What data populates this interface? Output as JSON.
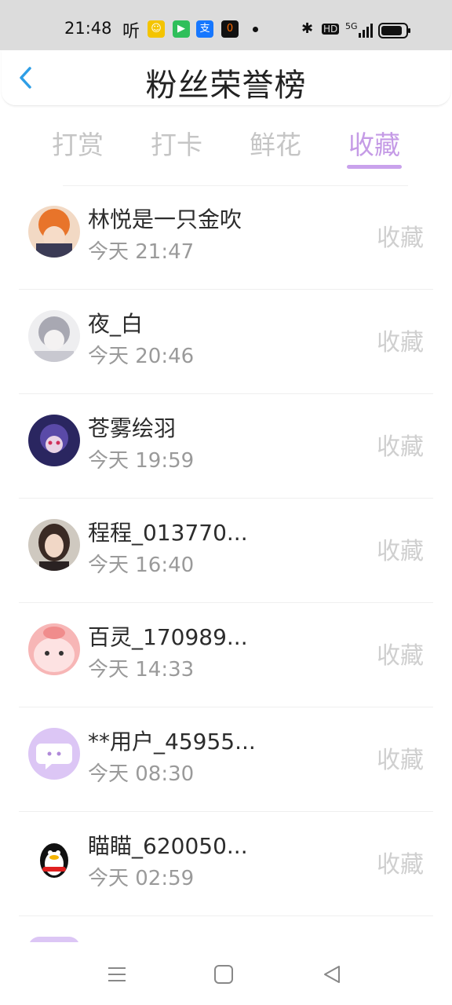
{
  "status_bar": {
    "time": "21:48",
    "app_text": "听",
    "network": "5G",
    "hd": "HD",
    "icons": [
      "bluetooth-icon",
      "signal-icon",
      "battery-icon"
    ]
  },
  "header": {
    "title": "粉丝荣誉榜",
    "back_icon": "chevron-left-icon"
  },
  "tabs": [
    {
      "label": "打赏"
    },
    {
      "label": "打卡"
    },
    {
      "label": "鲜花"
    },
    {
      "label": "收藏"
    }
  ],
  "active_tab": "收藏",
  "colors": {
    "accent": "#c59be6",
    "back": "#2e9ee6",
    "muted": "#cfcfcf"
  },
  "fans": [
    {
      "name": "林悦是一只金吹",
      "time": "今天 21:47",
      "action": "收藏"
    },
    {
      "name": "夜_白",
      "time": "今天 20:46",
      "action": "收藏"
    },
    {
      "name": "苍雾绘羽",
      "time": "今天 19:59",
      "action": "收藏"
    },
    {
      "name": "程程_013770...",
      "time": "今天 16:40",
      "action": "收藏"
    },
    {
      "name": "百灵_170989...",
      "time": "今天 14:33",
      "action": "收藏"
    },
    {
      "name": "**用户_45955...",
      "time": "今天 08:30",
      "action": "收藏"
    },
    {
      "name": "瞄瞄_620050...",
      "time": "今天 02:59",
      "action": "收藏"
    }
  ],
  "nav": [
    "menu-icon",
    "home-square-icon",
    "back-triangle-icon"
  ]
}
